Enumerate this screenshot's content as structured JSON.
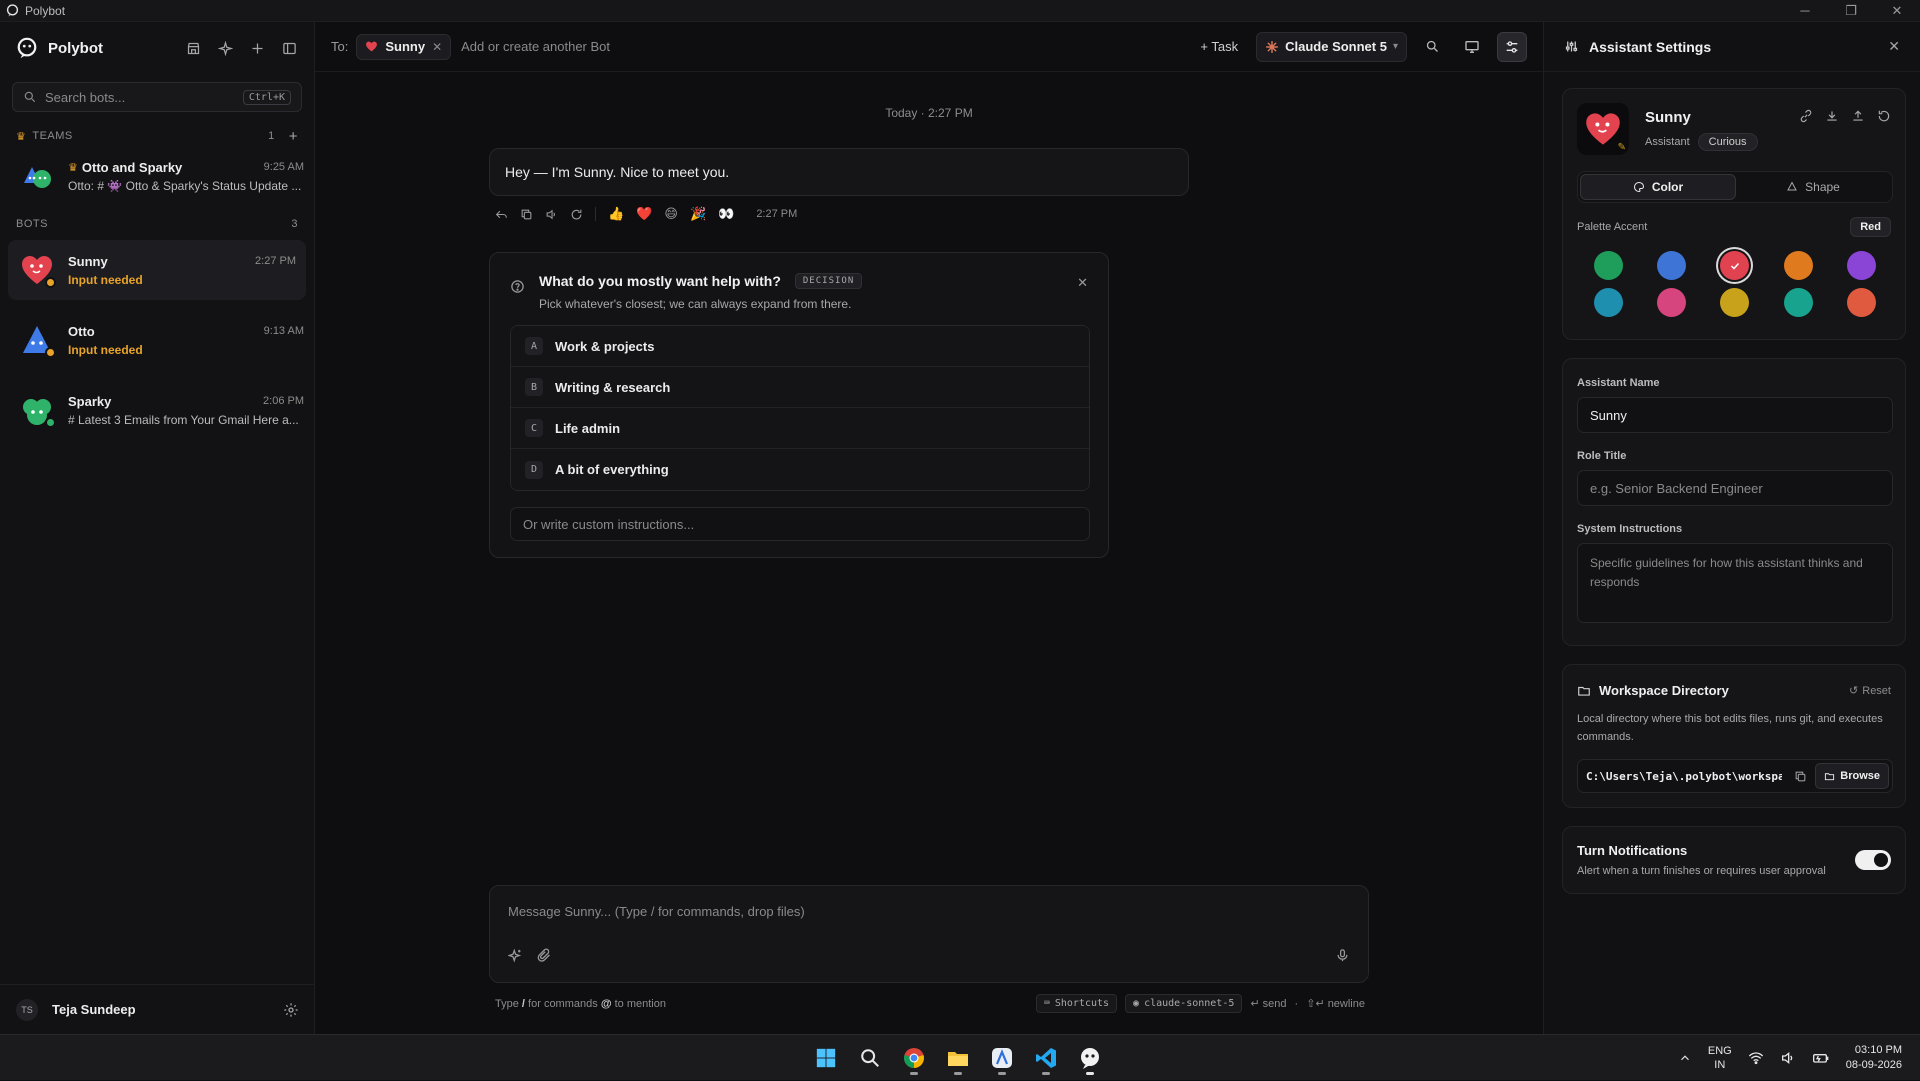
{
  "window": {
    "title": "Polybot"
  },
  "sidebar": {
    "brand": "Polybot",
    "search": {
      "placeholder": "Search bots...",
      "shortcut": "Ctrl+K"
    },
    "teams_header": "TEAMS",
    "teams_count": "1",
    "teams": [
      {
        "name": "Otto and Sparky",
        "time": "9:25 AM",
        "preview": "Otto: # 👾 Otto & Sparky's Status Update ..."
      }
    ],
    "bots_header": "BOTS",
    "bots_count": "3",
    "bots": [
      {
        "name": "Sunny",
        "time": "2:27 PM",
        "status": "Input needed",
        "color": "#e2434f"
      },
      {
        "name": "Otto",
        "time": "9:13 AM",
        "status": "Input needed",
        "color": "#3f7be8"
      },
      {
        "name": "Sparky",
        "time": "2:06 PM",
        "status": "# Latest 3 Emails from Your Gmail Here a...",
        "color": "#2fb36b"
      }
    ],
    "user": {
      "initials": "TS",
      "name": "Teja Sundeep"
    }
  },
  "topbar": {
    "to_label": "To:",
    "recipient": "Sunny",
    "add_placeholder": "Add or create another Bot",
    "task_label": "+ Task",
    "model_label": "Claude Sonnet 5"
  },
  "chat": {
    "day_separator": "Today · 2:27 PM",
    "message": "Hey — I'm Sunny. Nice to meet you.",
    "message_time": "2:27 PM",
    "reactions": [
      "👍",
      "❤️",
      "😄",
      "🎉",
      "👀"
    ],
    "decision": {
      "title": "What do you mostly want help with?",
      "tag": "DECISION",
      "subtitle": "Pick whatever's closest; we can always expand from there.",
      "options": [
        {
          "key": "A",
          "label": "Work & projects"
        },
        {
          "key": "B",
          "label": "Writing & research"
        },
        {
          "key": "C",
          "label": "Life admin"
        },
        {
          "key": "D",
          "label": "A bit of everything"
        }
      ],
      "custom_placeholder": "Or write custom instructions..."
    },
    "composer_placeholder": "Message Sunny... (Type / for commands, drop files)",
    "hints": {
      "left_prefix": "Type",
      "left_slash": "/",
      "left_mid": "for commands",
      "left_at": "@",
      "left_suffix": "to mention",
      "shortcuts": "Shortcuts",
      "model_id": "claude-sonnet-5",
      "send": "send",
      "newline": "newline"
    }
  },
  "panel": {
    "title": "Assistant Settings",
    "assistant_name": "Sunny",
    "role": "Assistant",
    "mood": "Curious",
    "tabs": {
      "color": "Color",
      "shape": "Shape"
    },
    "palette_label": "Palette Accent",
    "palette_value": "Red",
    "swatches": [
      "#1f9d5a",
      "#3d74d6",
      "#e0434f",
      "#e07a1f",
      "#8b45d6",
      "#1f8fb0",
      "#d6457e",
      "#c9a21c",
      "#18a38f",
      "#df5a3f"
    ],
    "selected_swatch": 2,
    "name_label": "Assistant Name",
    "name_value": "Sunny",
    "role_label": "Role Title",
    "role_placeholder": "e.g. Senior Backend Engineer",
    "sys_label": "System Instructions",
    "sys_placeholder": "Specific guidelines for how this assistant thinks and responds",
    "ws_title": "Workspace Directory",
    "ws_reset": "Reset",
    "ws_desc": "Local directory where this bot edits files, runs git, and executes commands.",
    "ws_path": "C:\\Users\\Teja\\.polybot\\workspace",
    "ws_browse": "Browse",
    "tn_title": "Turn Notifications",
    "tn_desc": "Alert when a turn finishes or requires user approval",
    "tn_enabled": true
  },
  "taskbar": {
    "lang1": "ENG",
    "lang2": "IN",
    "time": "03:10 PM",
    "date": "08-09-2026"
  }
}
